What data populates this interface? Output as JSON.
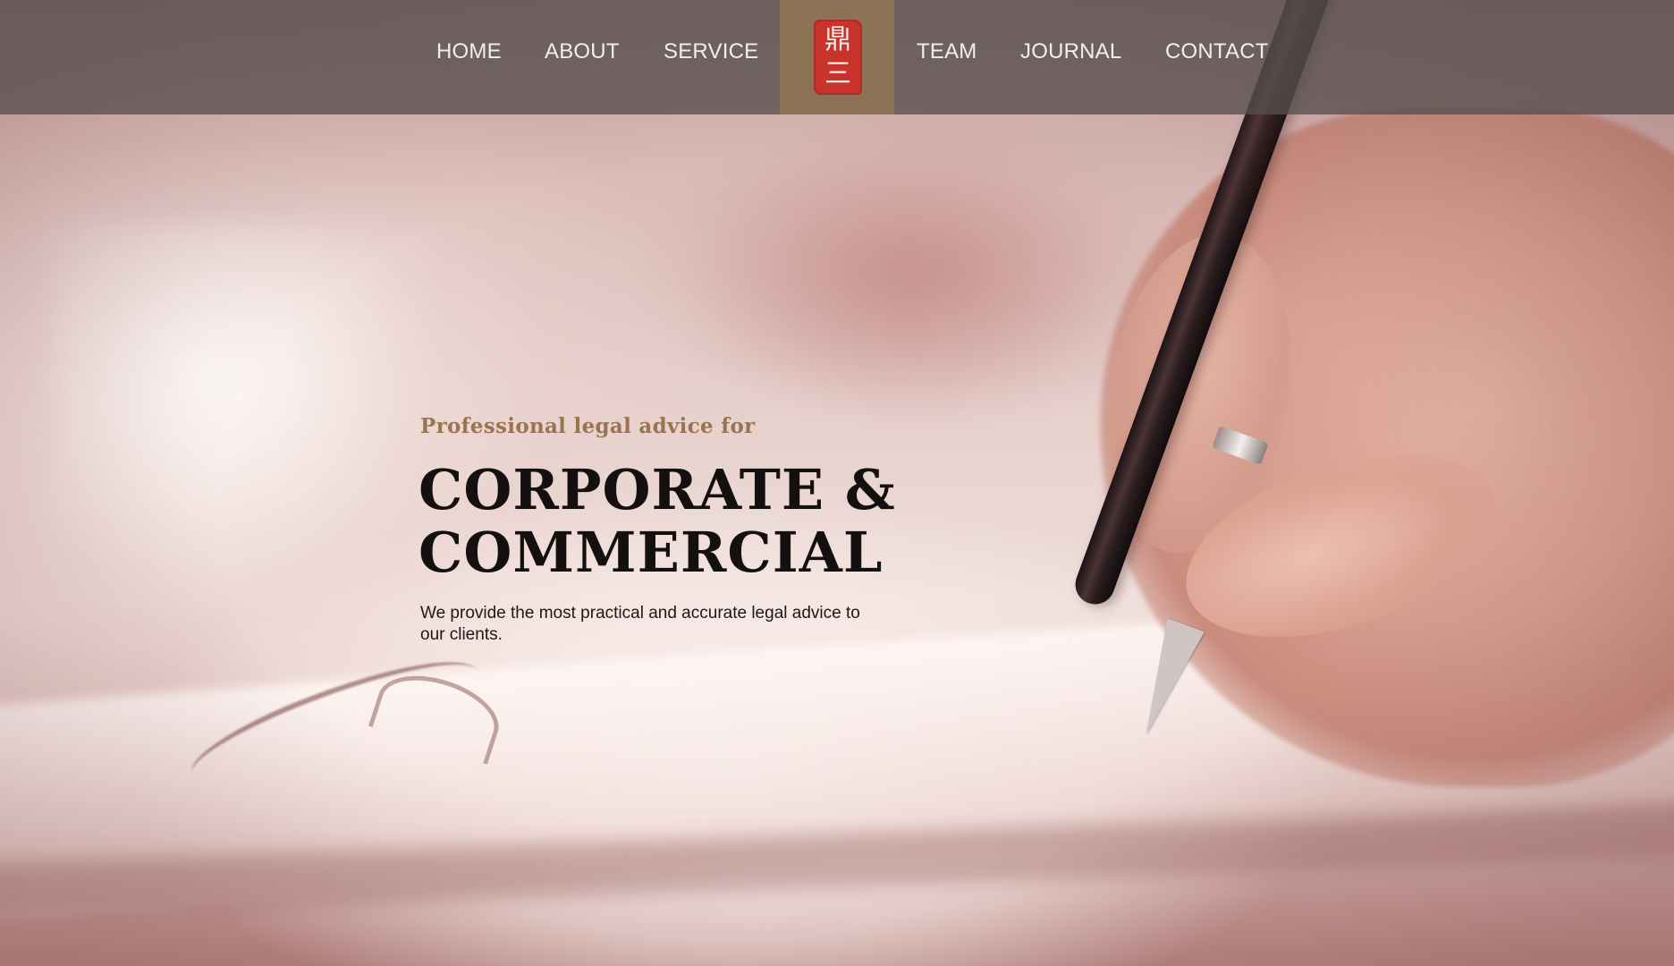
{
  "nav": {
    "items_left": [
      {
        "label": "HOME"
      },
      {
        "label": "ABOUT"
      },
      {
        "label": "SERVICE"
      }
    ],
    "items_right": [
      {
        "label": "TEAM"
      },
      {
        "label": "JOURNAL"
      },
      {
        "label": "CONTACT"
      }
    ],
    "logo": {
      "icon": "red-seal-logo-icon",
      "seal_text_top": "鼎",
      "seal_text_bottom": "三",
      "background_color": "#8c7356",
      "seal_color": "#c8332b"
    }
  },
  "hero": {
    "tagline": "Professional legal advice for",
    "headline_line1": "CORPORATE &",
    "headline_line2": "COMMERCIAL",
    "description": "We provide the most practical and accurate legal advice to our clients.",
    "tagline_color": "#9a7450",
    "headline_color": "#141010"
  }
}
